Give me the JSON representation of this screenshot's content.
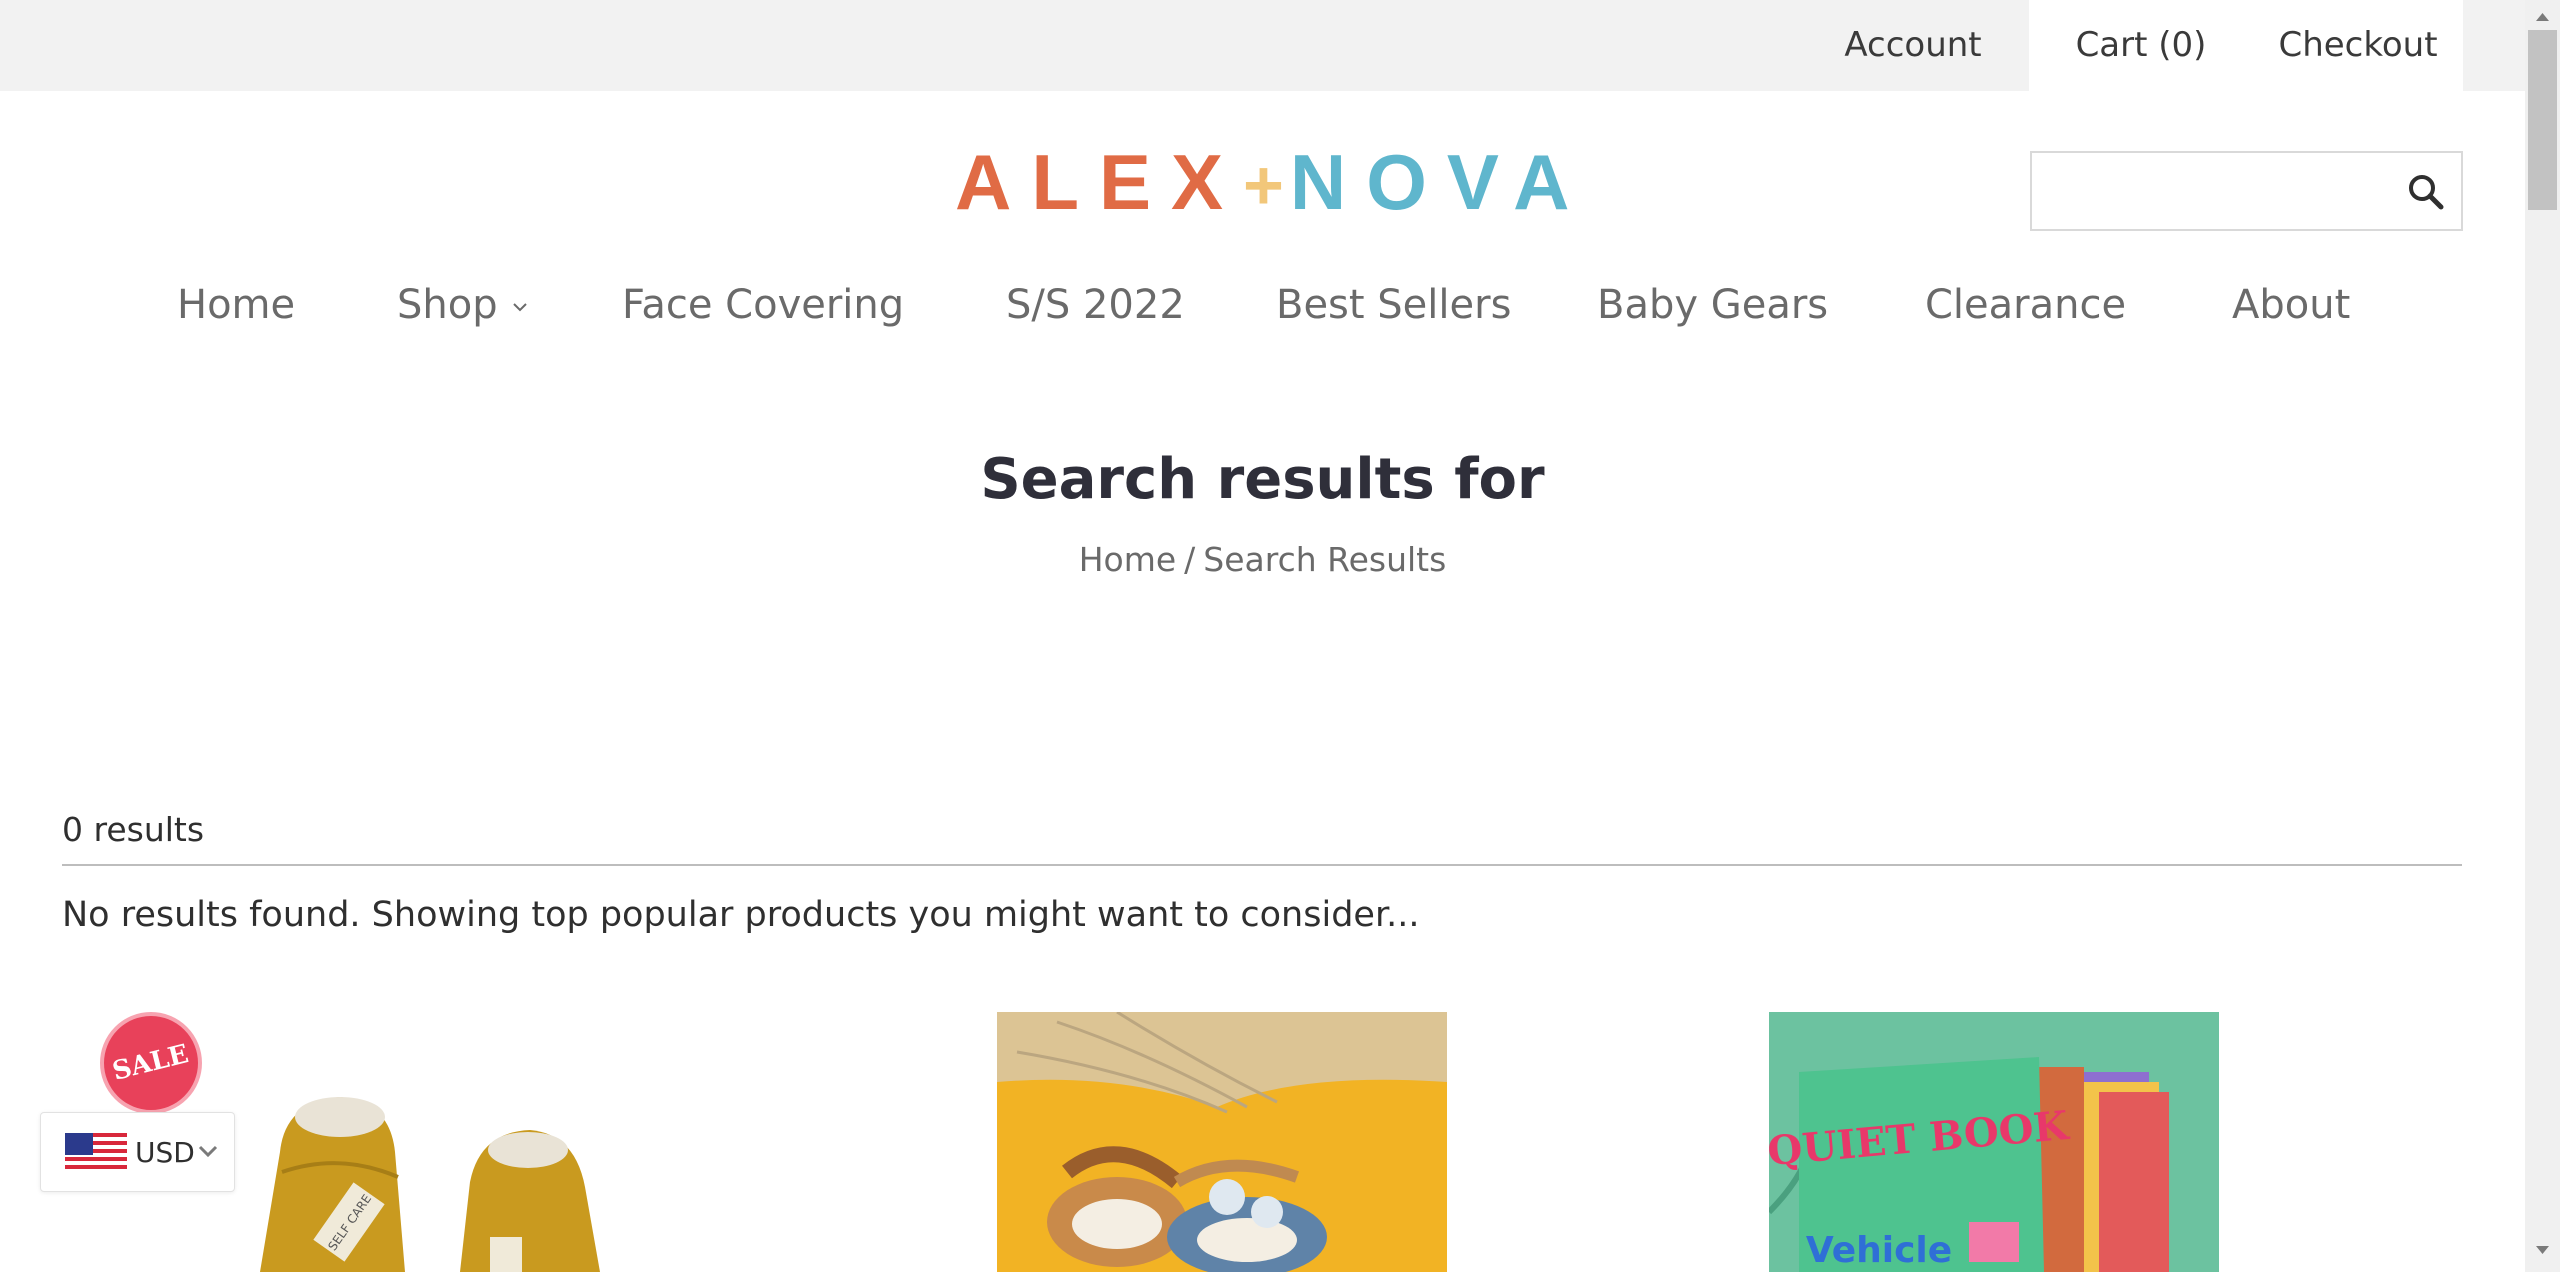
{
  "top_links": {
    "account": "Account",
    "cart": "Cart (0)",
    "checkout": "Checkout"
  },
  "logo": {
    "part1": "ALEX",
    "plus": "+",
    "part2": "NOVA",
    "colors": {
      "alex": "#e06b45",
      "plus": "#f2c77a",
      "nova": "#5fb6cd"
    }
  },
  "search": {
    "value": "",
    "placeholder": "",
    "icon": "search-icon"
  },
  "nav": {
    "items": [
      {
        "label": "Home"
      },
      {
        "label": "Shop",
        "icon": "chevron-down-icon"
      },
      {
        "label": "Face Covering"
      },
      {
        "label": "S/S 2022"
      },
      {
        "label": "Best Sellers"
      },
      {
        "label": "Baby Gears"
      },
      {
        "label": "Clearance"
      },
      {
        "label": "About"
      }
    ]
  },
  "main": {
    "title": "Search results for",
    "breadcrumb": {
      "home": "Home",
      "separator": "/",
      "current": "Search Results"
    },
    "results_count": "0 results",
    "no_results_message": "No results found. Showing top popular products you might want to consider..."
  },
  "products": {
    "badge": "SALE",
    "badge_color": "#e8415a",
    "book_text": "QUIET BOOK",
    "book_subtext": "Vehicle",
    "sock_label": "SELF CARE"
  },
  "currency": {
    "code": "USD",
    "flag": "us-flag-icon",
    "icon": "chevron-down-icon"
  }
}
